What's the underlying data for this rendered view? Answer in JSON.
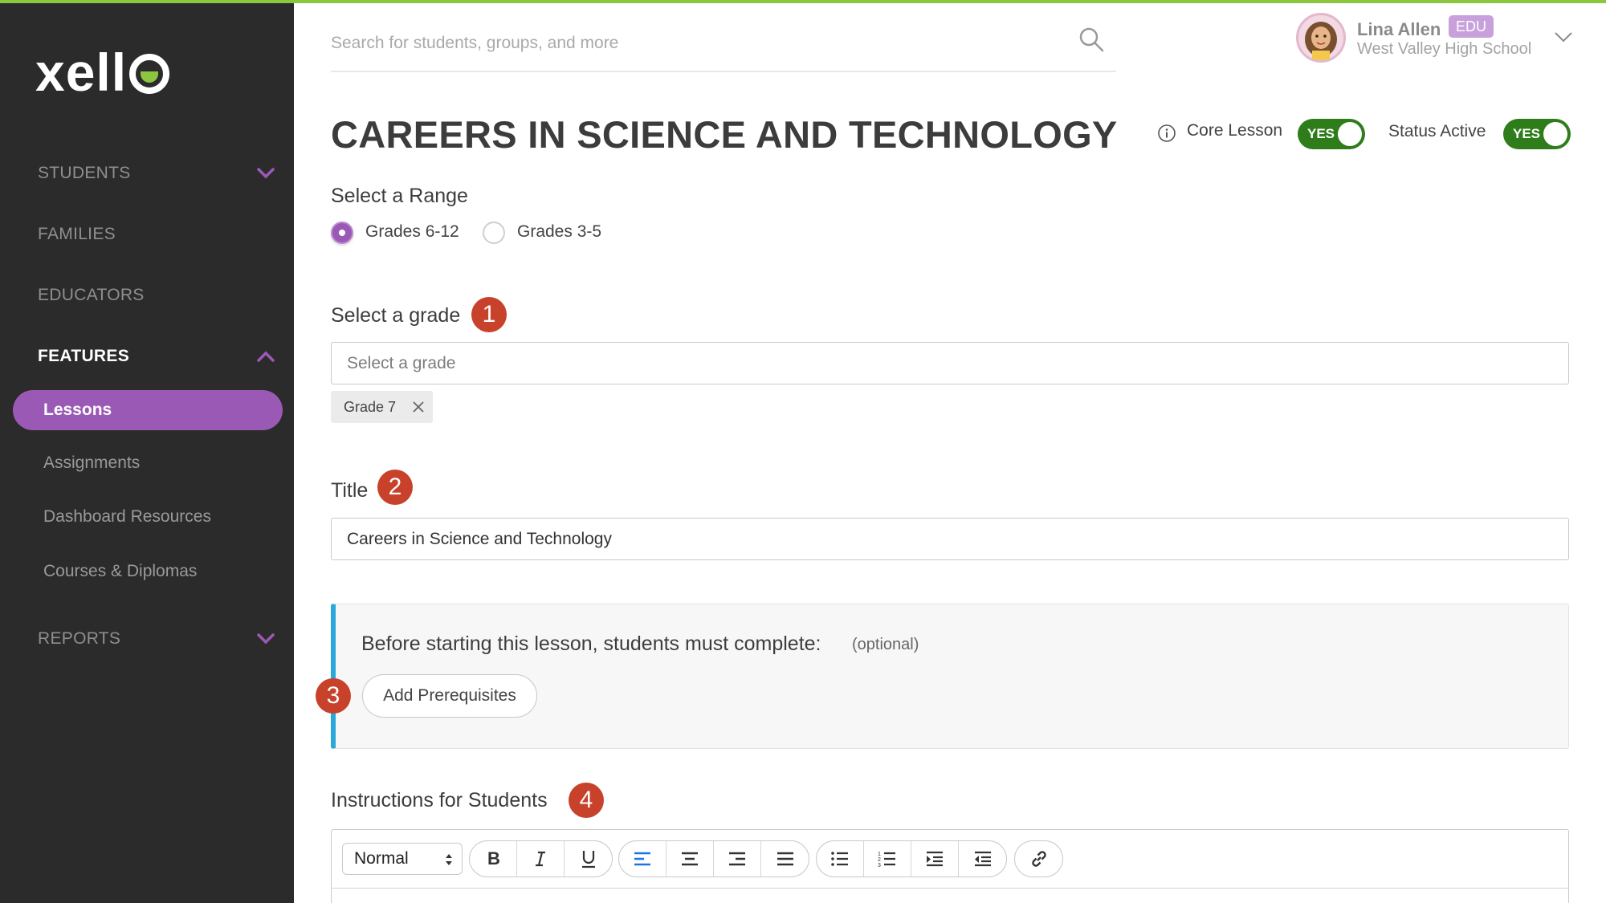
{
  "app": {
    "logo": "xell",
    "accent": "#9b59b6",
    "brand_green": "#8cc63f",
    "toggle_green": "#2e7d1a",
    "step_red": "#c8422b"
  },
  "sidebar": {
    "students": "STUDENTS",
    "families": "FAMILIES",
    "educators": "EDUCATORS",
    "features": "FEATURES",
    "sub_items": [
      "Lessons",
      "Assignments",
      "Dashboard Resources",
      "Courses & Diplomas"
    ],
    "reports": "REPORTS"
  },
  "header": {
    "search_placeholder": "Search for students, groups, and more",
    "user_name": "Lina Allen",
    "user_badge": "EDU",
    "user_school": "West Valley High School"
  },
  "page": {
    "title": "CAREERS IN SCIENCE AND TECHNOLOGY",
    "core_lesson_label": "Core Lesson",
    "core_lesson_value": "YES",
    "status_label": "Status Active",
    "status_value": "YES"
  },
  "form": {
    "range_label": "Select a Range",
    "range_options": [
      "Grades 6-12",
      "Grades 3-5"
    ],
    "range_selected": "Grades 6-12",
    "grade_label": "Select a grade",
    "grade_placeholder": "Select a grade",
    "grade_chips": [
      "Grade 7"
    ],
    "title_label": "Title",
    "title_value": "Careers in Science and Technology",
    "prereq_text": "Before starting this lesson, students must complete:",
    "prereq_optional": "(optional)",
    "prereq_button": "Add Prerequisites",
    "instructions_label": "Instructions for Students",
    "steps": [
      "1",
      "2",
      "3",
      "4"
    ]
  },
  "editor": {
    "format_value": "Normal",
    "format_options": [
      "Normal"
    ]
  }
}
